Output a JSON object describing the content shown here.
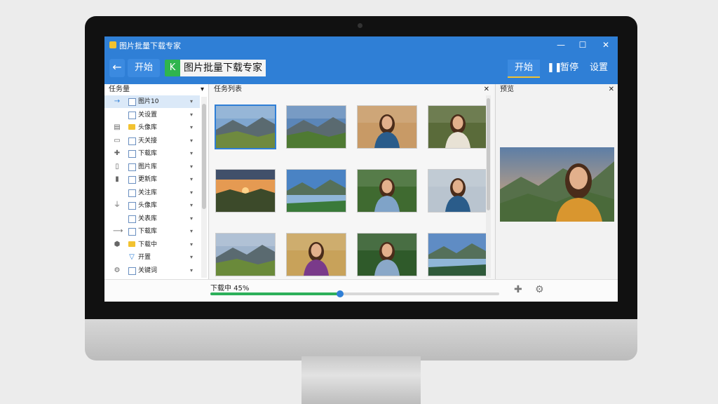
{
  "window": {
    "title": "图片批量下载专家",
    "min_glyph": "—",
    "max_glyph": "☐",
    "close_glyph": "✕"
  },
  "toolbar": {
    "back_icon": "←",
    "start_left": "开始",
    "brand_icon": "K",
    "brand_title": "图片批量下载专家",
    "start_right": "开始",
    "pause_icon": "❚❚",
    "pause": "暂停",
    "settings": "设置"
  },
  "left_panel": {
    "header": "任务量",
    "header_close": "▾",
    "items": [
      {
        "label": "图片10",
        "kind": "check",
        "icon": "→",
        "selected": true
      },
      {
        "label": "关设置",
        "kind": "check",
        "icon": "",
        "selected": false
      },
      {
        "label": "头像库",
        "kind": "folder",
        "icon": "▤",
        "selected": false
      },
      {
        "label": "天关接",
        "kind": "check",
        "icon": "▭",
        "selected": false
      },
      {
        "label": "下载库",
        "kind": "check",
        "icon": "✚",
        "selected": false
      },
      {
        "label": "图片库",
        "kind": "check",
        "icon": "▯",
        "selected": false
      },
      {
        "label": "更新库",
        "kind": "check",
        "icon": "▮",
        "selected": false
      },
      {
        "label": "关注库",
        "kind": "check",
        "icon": "",
        "selected": false
      },
      {
        "label": "头像库",
        "kind": "check",
        "icon": "⏚",
        "selected": false
      },
      {
        "label": "关表库",
        "kind": "check",
        "icon": "",
        "selected": false
      },
      {
        "label": "下载库",
        "kind": "check",
        "icon": "⟶",
        "selected": false
      },
      {
        "label": "下载中",
        "kind": "folder",
        "icon": "⬢",
        "selected": false
      },
      {
        "label": "开置",
        "kind": "filter",
        "icon": "",
        "selected": false
      },
      {
        "label": "关键词",
        "kind": "check",
        "icon": "⚙",
        "selected": false
      }
    ]
  },
  "center_panel": {
    "header": "任务列表",
    "header_close": "✕",
    "thumbnails": [
      {
        "type": "mountain",
        "sky": "#7fa6cf",
        "land": "#6f8a3f",
        "selected": true
      },
      {
        "type": "mountain",
        "sky": "#5b86b8",
        "land": "#4f7a33",
        "selected": false
      },
      {
        "type": "portrait",
        "bg": "#c89a66",
        "shirt": "#2a5c8a",
        "selected": false
      },
      {
        "type": "portrait",
        "bg": "#5a6b3a",
        "shirt": "#e8e2d5",
        "selected": false
      },
      {
        "type": "sunset",
        "sky": "#e59a52",
        "land": "#3c4a2a",
        "selected": false
      },
      {
        "type": "lake",
        "sky": "#4a83c4",
        "land": "#3a7a3a",
        "selected": false
      },
      {
        "type": "portrait",
        "bg": "#3f6a30",
        "shirt": "#7fa3c8",
        "selected": false
      },
      {
        "type": "portrait",
        "bg": "#b9c4cf",
        "shirt": "#2a5c8a",
        "selected": false
      },
      {
        "type": "mountain",
        "sky": "#9fb4cc",
        "land": "#6a8a3a",
        "selected": false
      },
      {
        "type": "portrait",
        "bg": "#c8a25a",
        "shirt": "#7a3a8a",
        "selected": false
      },
      {
        "type": "portrait",
        "bg": "#2f5a2a",
        "shirt": "#8aa8c8",
        "selected": false
      },
      {
        "type": "lake",
        "sky": "#5f8cc4",
        "land": "#2f5a3a",
        "selected": false
      }
    ]
  },
  "right_panel": {
    "header": "预览",
    "header_close": "✕",
    "preview": {
      "sky": "#e5ad74",
      "hill": "#4a6a3a",
      "shirt": "#d9962f"
    }
  },
  "status": {
    "text": "下载中 45%",
    "progress": 0.45,
    "add_icon": "✚",
    "settings_icon": "⚙"
  },
  "colors": {
    "accent": "#2f7fd6",
    "progress": "#2db05a",
    "brand_green": "#2fb54e"
  }
}
